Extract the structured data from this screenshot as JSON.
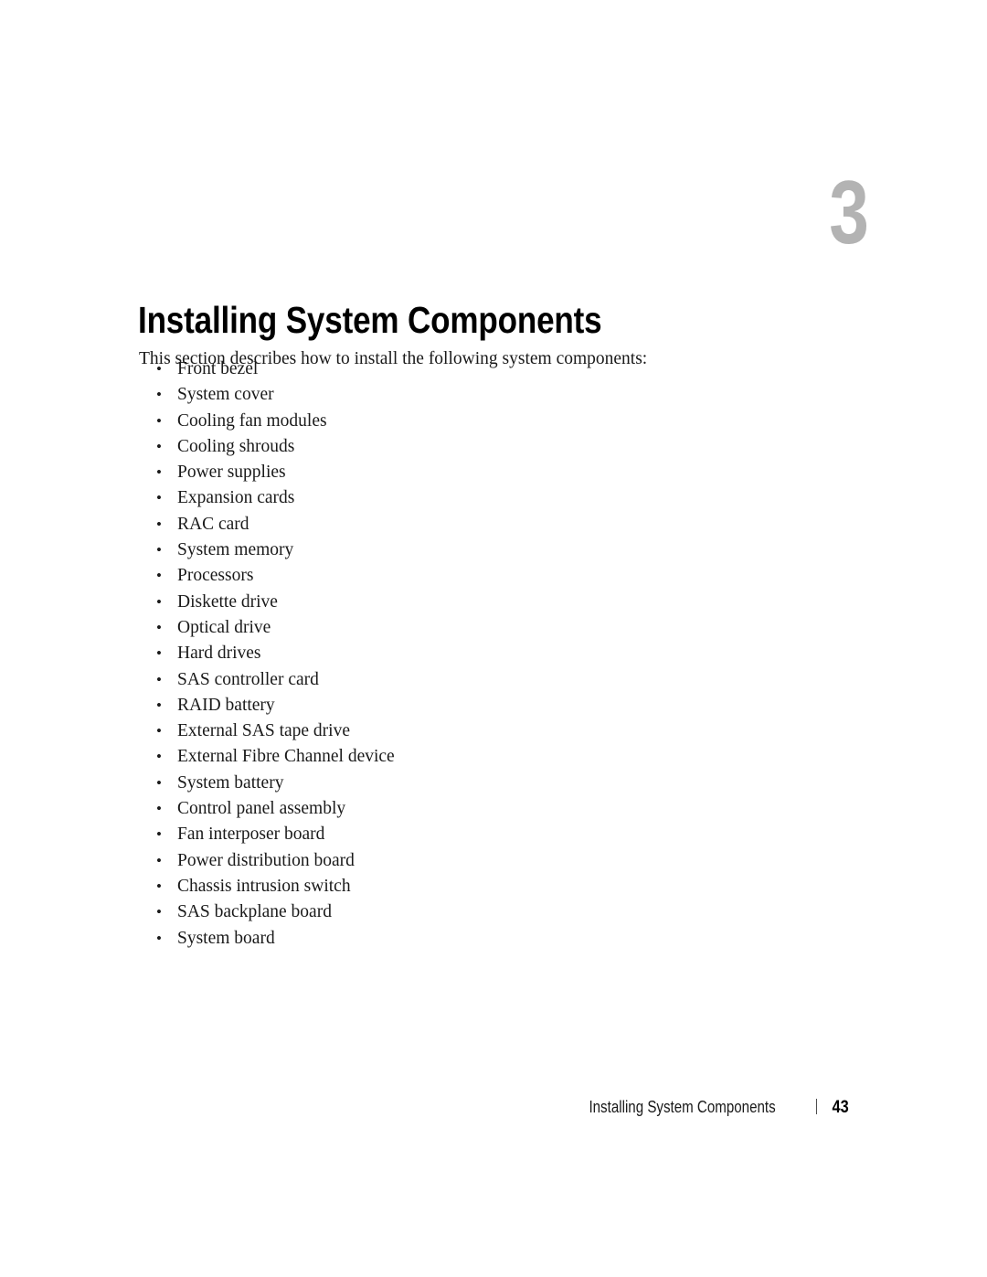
{
  "chapter": {
    "number": "3",
    "number_color": "#b3b3b3",
    "title": "Installing System Components"
  },
  "intro": {
    "text": "This section describes how to install the following system components:"
  },
  "components": {
    "bullet_glyph": "•",
    "items": [
      "Front bezel",
      "System cover",
      "Cooling fan modules",
      "Cooling shrouds",
      "Power supplies",
      "Expansion cards",
      "RAC card",
      "System memory",
      "Processors",
      "Diskette drive",
      "Optical drive",
      "Hard drives",
      "SAS controller card",
      "RAID battery",
      "External SAS tape drive",
      "External Fibre Channel device",
      "System battery",
      "Control panel assembly",
      "Fan interposer board",
      "Power distribution board",
      "Chassis intrusion switch",
      "SAS backplane board",
      "System board"
    ]
  },
  "footer": {
    "title": "Installing System Components",
    "page_number": "43"
  }
}
